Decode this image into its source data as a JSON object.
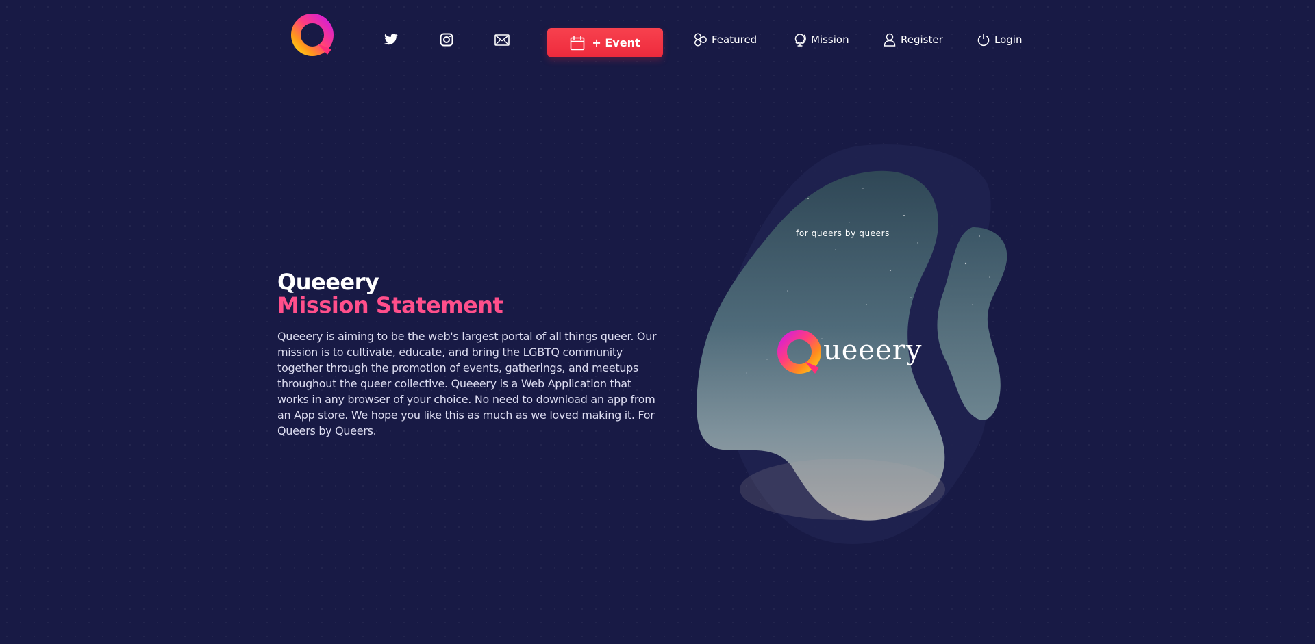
{
  "header": {
    "event_button_label": "+ Event",
    "nav": [
      {
        "label": "Featured",
        "icon": "featured-circles-icon"
      },
      {
        "label": "Mission",
        "icon": "globe-icon"
      },
      {
        "label": "Register",
        "icon": "user-icon"
      },
      {
        "label": "Login",
        "icon": "power-icon"
      }
    ],
    "social": [
      {
        "icon": "twitter-icon"
      },
      {
        "icon": "instagram-icon"
      },
      {
        "icon": "mail-icon"
      }
    ]
  },
  "mission": {
    "title_line1": "Queeery",
    "title_line2": "Mission Statement",
    "body": "Queeery is aiming to be the web's largest portal of all things queer. Our mission is to cultivate, educate, and bring the LGBTQ community together through the promotion of events, gatherings, and meetups throughout the queer collective. Queeery is a Web Application that works in any browser of your choice. No need to download an app from an App store. We hope you like this as much as we loved making it. For Queers by Queers."
  },
  "hero": {
    "tagline": "for queers by queers",
    "wordmark": "ueeery"
  },
  "colors": {
    "background": "#181a45",
    "accent_red": "#ee2a3c",
    "accent_pink": "#ff4f8b"
  }
}
